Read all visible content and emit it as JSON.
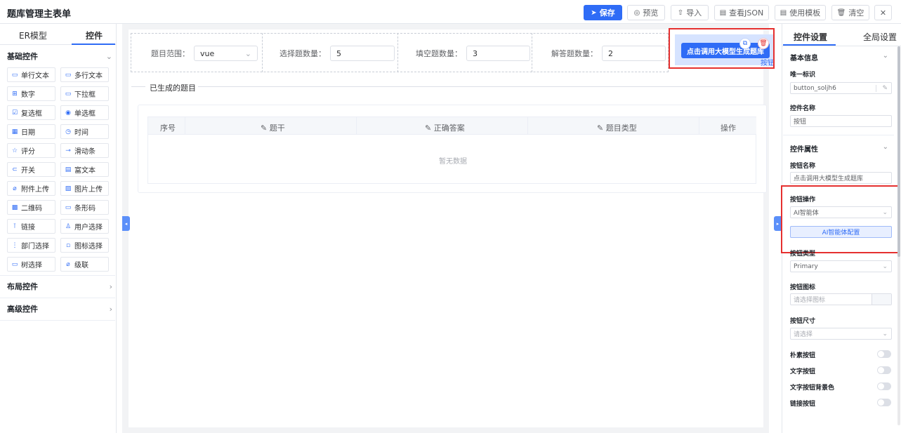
{
  "app": {
    "title": "题库管理主表单"
  },
  "toolbar": {
    "save": "保存",
    "preview": "预览",
    "import": "导入",
    "view_json": "查看JSON",
    "use_template": "使用模板",
    "clear": "清空",
    "close": "✕"
  },
  "left": {
    "tabs": [
      "ER模型",
      "控件"
    ],
    "sections": {
      "basic": "基础控件",
      "layout": "布局控件",
      "advanced": "高级控件"
    },
    "components": [
      {
        "label": "单行文本",
        "icon": "▭"
      },
      {
        "label": "多行文本",
        "icon": "▭"
      },
      {
        "label": "数字",
        "icon": "⊞"
      },
      {
        "label": "下拉框",
        "icon": "▭"
      },
      {
        "label": "复选框",
        "icon": "☑"
      },
      {
        "label": "单选框",
        "icon": "◉"
      },
      {
        "label": "日期",
        "icon": "▦"
      },
      {
        "label": "时间",
        "icon": "◷"
      },
      {
        "label": "评分",
        "icon": "☆"
      },
      {
        "label": "滑动条",
        "icon": "⊸"
      },
      {
        "label": "开关",
        "icon": "⊂"
      },
      {
        "label": "富文本",
        "icon": "▤"
      },
      {
        "label": "附件上传",
        "icon": "⌀"
      },
      {
        "label": "图片上传",
        "icon": "▨"
      },
      {
        "label": "二维码",
        "icon": "▩"
      },
      {
        "label": "条形码",
        "icon": "▭"
      },
      {
        "label": "链接",
        "icon": "⊺"
      },
      {
        "label": "用户选择",
        "icon": "♙"
      },
      {
        "label": "部门选择",
        "icon": "⋮"
      },
      {
        "label": "图标选择",
        "icon": "▫"
      },
      {
        "label": "树选择",
        "icon": "▭"
      },
      {
        "label": "级联",
        "icon": "⌀"
      }
    ]
  },
  "form": {
    "fields": [
      {
        "label": "题目范围：",
        "value": "vue"
      },
      {
        "label": "选择题数量：",
        "value": "5"
      },
      {
        "label": "填空题数量：",
        "value": "3"
      },
      {
        "label": "解答题数量：",
        "value": "2"
      }
    ],
    "generate_button": "点击调用大模型生成题库",
    "button_tag": "按钮",
    "divider_title": "已生成的题目",
    "table": {
      "headers": [
        "序号",
        "题干",
        "正确答案",
        "题目类型",
        "操作"
      ],
      "empty_text": "暂无数据"
    }
  },
  "right": {
    "tabs": [
      "控件设置",
      "全局设置"
    ],
    "basic_info": "基本信息",
    "unique_id_label": "唯一标识",
    "unique_id_value": "button_soljh6",
    "control_name_label": "控件名称",
    "control_name_value": "按钮",
    "props_section": "控件属性",
    "btn_name_label": "按钮名称",
    "btn_name_value": "点击调用大模型生成题库",
    "btn_action_label": "按钮操作",
    "btn_action_value": "AI智能体",
    "ai_config_button": "AI智能体配置",
    "btn_type_label": "按钮类型",
    "btn_type_value": "Primary",
    "btn_icon_label": "按钮图标",
    "btn_icon_placeholder": "请选择图标",
    "btn_size_label": "按钮尺寸",
    "btn_size_placeholder": "请选择",
    "switches": [
      "朴素按钮",
      "文字按钮",
      "文字按钮背景色",
      "链接按钮"
    ]
  }
}
